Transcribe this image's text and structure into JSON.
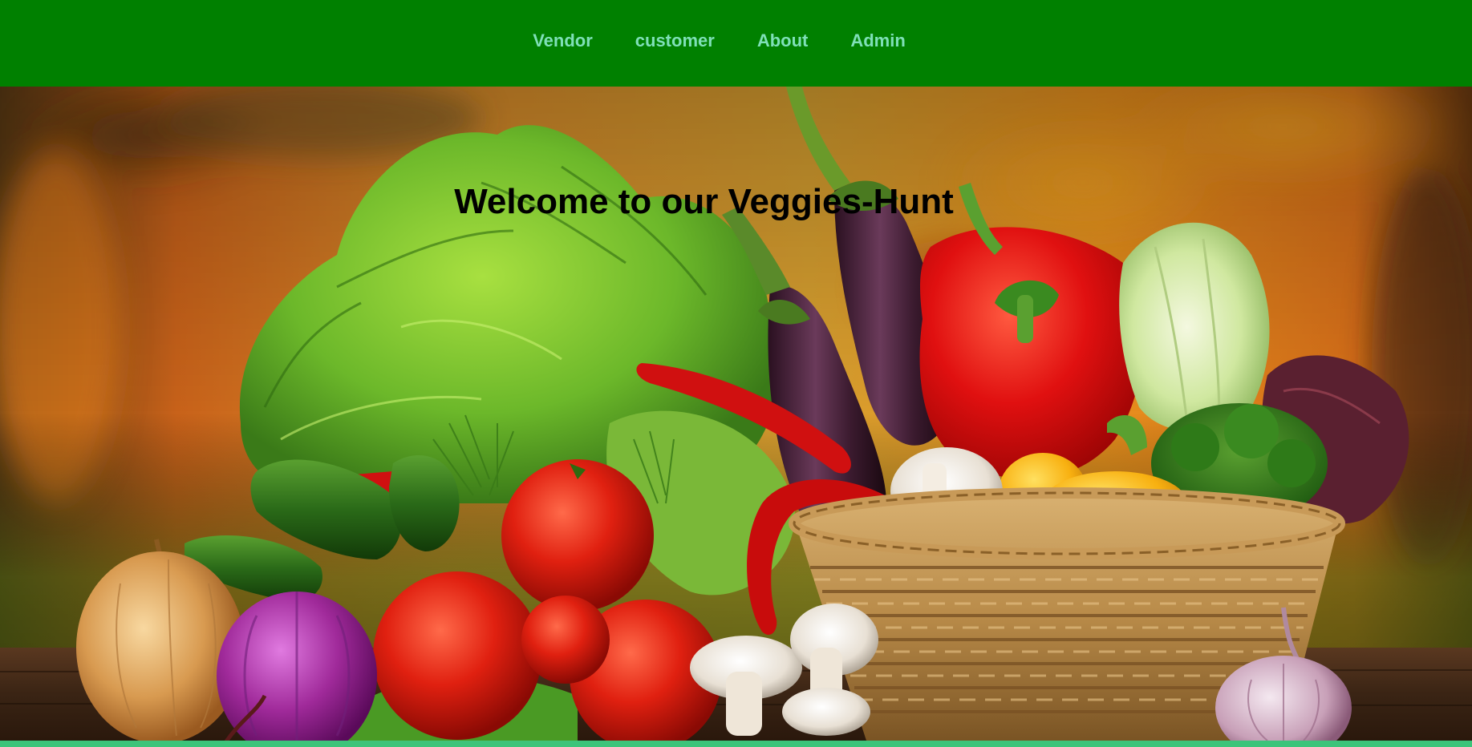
{
  "nav": {
    "items": [
      {
        "label": "Vendor"
      },
      {
        "label": "customer"
      },
      {
        "label": "About"
      },
      {
        "label": "Admin"
      }
    ]
  },
  "hero": {
    "title": "Welcome to our Veggies-Hunt",
    "image": "vegetable-basket-photo"
  },
  "colors": {
    "nav_background": "#008000",
    "nav_link": "#7fe0b8",
    "footer_strip": "#3cc47a",
    "title": "#000000"
  }
}
